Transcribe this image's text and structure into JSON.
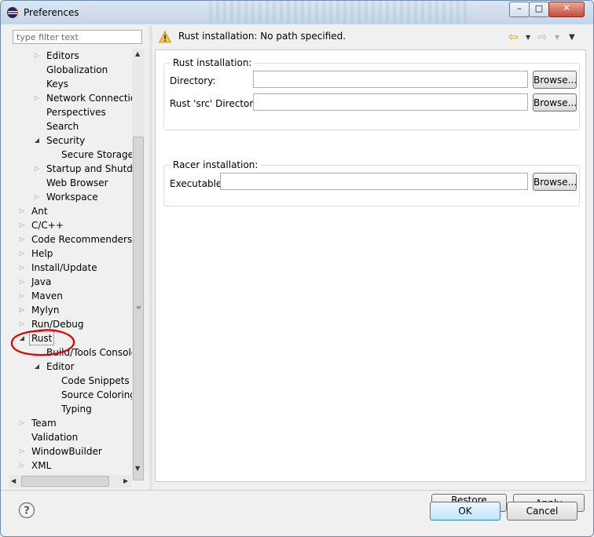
{
  "window": {
    "title": "Preferences",
    "controls": {
      "minimize": "–",
      "maximize": "□",
      "close": "✕"
    }
  },
  "filter": {
    "placeholder": "type filter text"
  },
  "tree": {
    "items": [
      {
        "label": "Editors",
        "toggle": "▷"
      },
      {
        "label": "Globalization",
        "toggle": ""
      },
      {
        "label": "Keys",
        "toggle": ""
      },
      {
        "label": "Network Connections",
        "toggle": "▷"
      },
      {
        "label": "Perspectives",
        "toggle": ""
      },
      {
        "label": "Search",
        "toggle": ""
      },
      {
        "label": "Security",
        "toggle": "◢"
      },
      {
        "label": "Secure Storage",
        "toggle": ""
      },
      {
        "label": "Startup and Shutdown",
        "toggle": "▷"
      },
      {
        "label": "Web Browser",
        "toggle": ""
      },
      {
        "label": "Workspace",
        "toggle": "▷"
      },
      {
        "label": "Ant",
        "toggle": "▷"
      },
      {
        "label": "C/C++",
        "toggle": "▷"
      },
      {
        "label": "Code Recommenders",
        "toggle": "▷"
      },
      {
        "label": "Help",
        "toggle": "▷"
      },
      {
        "label": "Install/Update",
        "toggle": "▷"
      },
      {
        "label": "Java",
        "toggle": "▷"
      },
      {
        "label": "Maven",
        "toggle": "▷"
      },
      {
        "label": "Mylyn",
        "toggle": "▷"
      },
      {
        "label": "Run/Debug",
        "toggle": "▷"
      },
      {
        "label": "Rust",
        "toggle": "◢"
      },
      {
        "label": "Build/Tools Console",
        "toggle": ""
      },
      {
        "label": "Editor",
        "toggle": "◢"
      },
      {
        "label": "Code Snippets",
        "toggle": ""
      },
      {
        "label": "Source Coloring",
        "toggle": ""
      },
      {
        "label": "Typing",
        "toggle": ""
      },
      {
        "label": "Team",
        "toggle": "▷"
      },
      {
        "label": "Validation",
        "toggle": ""
      },
      {
        "label": "WindowBuilder",
        "toggle": "▷"
      },
      {
        "label": "XML",
        "toggle": "▷"
      }
    ]
  },
  "message": {
    "text": "Rust installation: No path specified."
  },
  "rust_group": {
    "title": "Rust installation:",
    "directory_label": "Directory:",
    "directory_value": "",
    "src_label": "Rust 'src' Directory:",
    "src_value": "",
    "browse_label": "Browse..."
  },
  "racer_group": {
    "title": "Racer installation:",
    "executable_label": "Executable:",
    "executable_value": "",
    "browse_label": "Browse..."
  },
  "buttons": {
    "restore_defaults": "Restore Defaults",
    "apply": "Apply",
    "ok": "OK",
    "cancel": "Cancel"
  },
  "colors": {
    "annotation_circle": "#e00000",
    "default_button": "#3c7fb1"
  }
}
